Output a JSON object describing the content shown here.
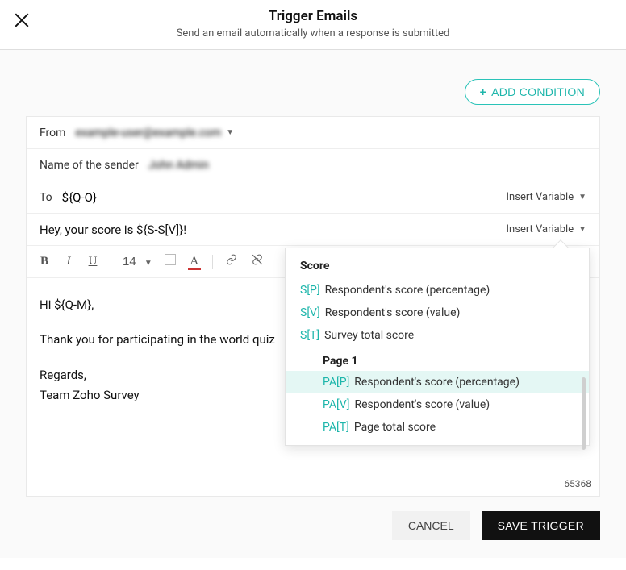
{
  "header": {
    "title": "Trigger Emails",
    "subtitle": "Send an email automatically when a response is submitted"
  },
  "add_condition_label": "ADD CONDITION",
  "from": {
    "label": "From",
    "value": "example-user@example.com"
  },
  "sender_name": {
    "label": "Name of the sender",
    "value": "John Admin"
  },
  "to": {
    "label": "To",
    "value": "${Q-O}",
    "insert_variable_label": "Insert Variable"
  },
  "subject": {
    "text": "Hey, your score is ${S-S[V]}!",
    "insert_variable_label": "Insert Variable"
  },
  "toolbar": {
    "font_size": "14"
  },
  "body": {
    "greeting": "Hi ${Q-M},",
    "line1": "Thank you for participating in the world quiz",
    "regards": "Regards,",
    "team": "Team Zoho Survey"
  },
  "char_count": "65368",
  "dropdown": {
    "title": "Score",
    "items": [
      {
        "code": "S[P]",
        "label": "Respondent's score (percentage)"
      },
      {
        "code": "S[V]",
        "label": "Respondent's score (value)"
      },
      {
        "code": "S[T]",
        "label": "Survey total score"
      }
    ],
    "subhead": "Page 1",
    "page_items": [
      {
        "code": "PA[P]",
        "label": "Respondent's score (percentage)",
        "highlight": true
      },
      {
        "code": "PA[V]",
        "label": "Respondent's score (value)"
      },
      {
        "code": "PA[T]",
        "label": "Page total score"
      }
    ]
  },
  "footer": {
    "cancel": "CANCEL",
    "save": "SAVE TRIGGER"
  }
}
